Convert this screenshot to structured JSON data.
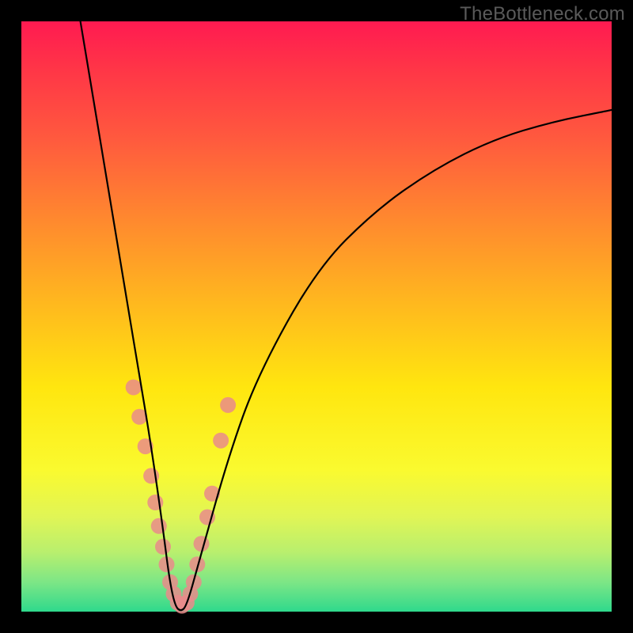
{
  "watermark": "TheBottleneck.com",
  "chart_data": {
    "type": "line",
    "title": "",
    "xlabel": "",
    "ylabel": "",
    "xlim": [
      0,
      100
    ],
    "ylim": [
      0,
      100
    ],
    "grid": false,
    "series": [
      {
        "name": "bottleneck-curve",
        "color": "#000000",
        "x": [
          10,
          12,
          14,
          16,
          18,
          20,
          22,
          24,
          25,
          26,
          27,
          28,
          30,
          35,
          40,
          50,
          60,
          70,
          80,
          90,
          100
        ],
        "y": [
          100,
          88,
          76,
          64,
          52,
          40,
          28,
          14,
          6,
          1,
          0,
          1,
          8,
          26,
          40,
          58,
          68,
          75,
          80,
          83,
          85
        ]
      },
      {
        "name": "highlight-dots",
        "color": "#e98b8b",
        "x": [
          19.0,
          20.0,
          21.0,
          22.0,
          22.7,
          23.3,
          24.0,
          24.6,
          25.2,
          25.8,
          26.5,
          27.2,
          28.0,
          28.6,
          29.2,
          29.8,
          30.5,
          31.5,
          32.3,
          33.8,
          35.0
        ],
        "y": [
          38.0,
          33.0,
          28.0,
          23.0,
          18.5,
          14.5,
          11.0,
          8.0,
          5.0,
          3.0,
          1.5,
          1.0,
          1.5,
          3.0,
          5.0,
          8.0,
          11.5,
          16.0,
          20.0,
          29.0,
          35.0
        ]
      }
    ]
  }
}
